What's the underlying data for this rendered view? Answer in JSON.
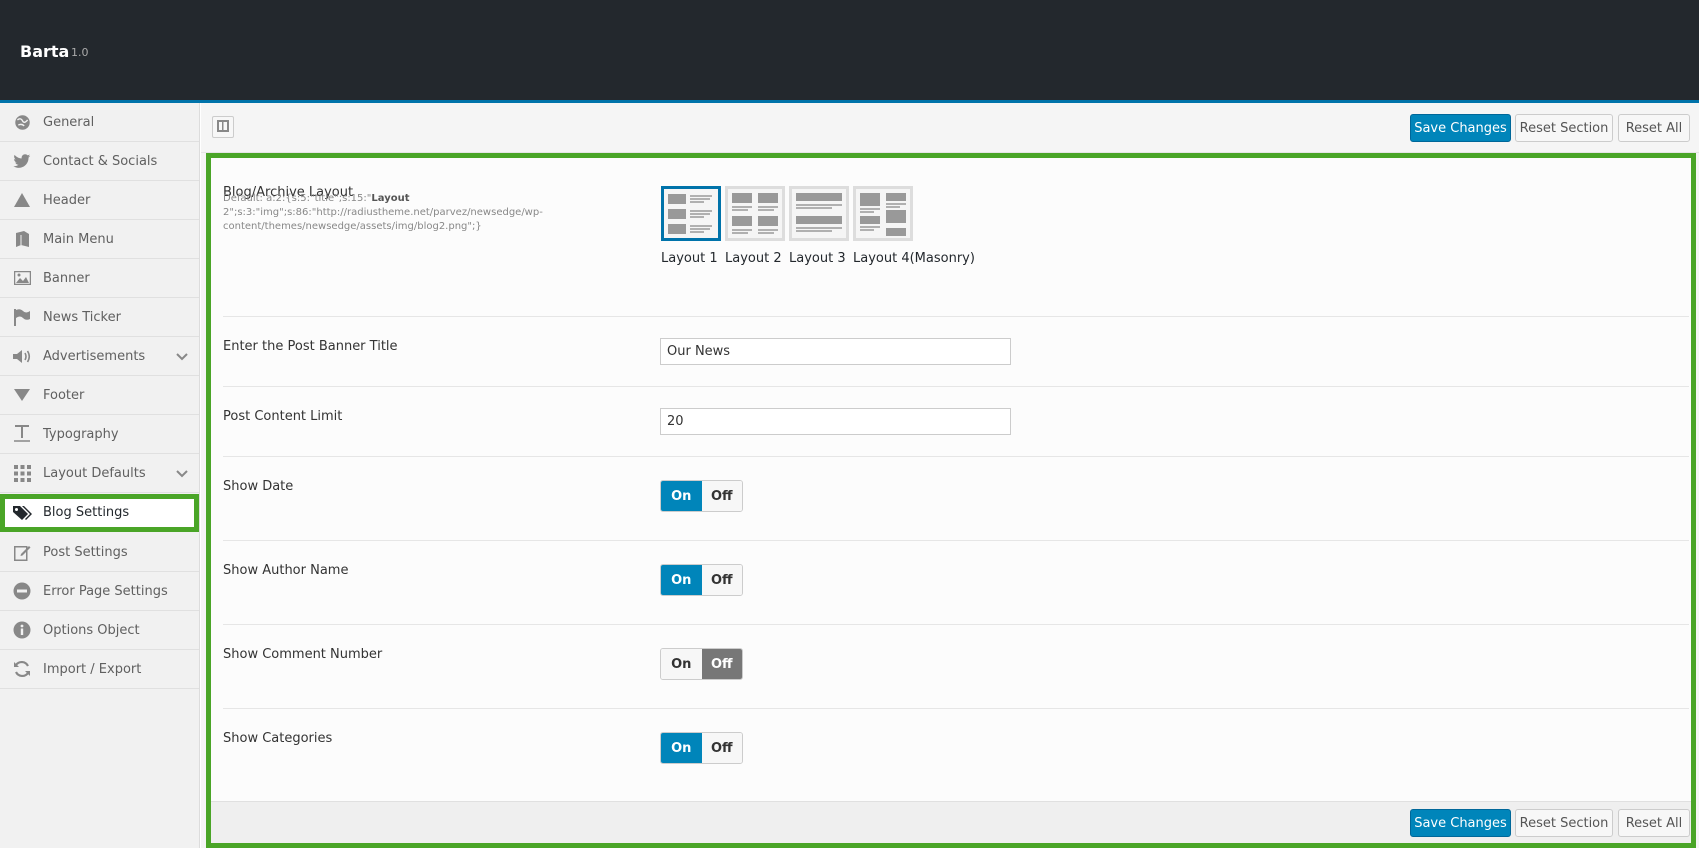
{
  "app": {
    "title": "Barta",
    "version": "1.0"
  },
  "sidebar": {
    "items": [
      {
        "label": "General",
        "icon": "globe-icon",
        "active": false
      },
      {
        "label": "Contact & Socials",
        "icon": "twitter-icon",
        "active": false
      },
      {
        "label": "Header",
        "icon": "triangle-icon",
        "active": false
      },
      {
        "label": "Main Menu",
        "icon": "book-icon",
        "active": false
      },
      {
        "label": "Banner",
        "icon": "image-icon",
        "active": false
      },
      {
        "label": "News Ticker",
        "icon": "flag-icon",
        "active": false
      },
      {
        "label": "Advertisements",
        "icon": "megaphone-icon",
        "active": false,
        "expandable": true
      },
      {
        "label": "Footer",
        "icon": "caret-down-icon",
        "active": false
      },
      {
        "label": "Typography",
        "icon": "text-icon",
        "active": false
      },
      {
        "label": "Layout Defaults",
        "icon": "grid-icon",
        "active": false,
        "expandable": true
      },
      {
        "label": "Blog Settings",
        "icon": "tags-icon",
        "active": true
      },
      {
        "label": "Post Settings",
        "icon": "edit-icon",
        "active": false
      },
      {
        "label": "Error Page Settings",
        "icon": "minus-circle-icon",
        "active": false
      },
      {
        "label": "Options Object",
        "icon": "info-icon",
        "active": false
      },
      {
        "label": "Import / Export",
        "icon": "refresh-icon",
        "active": false
      }
    ]
  },
  "toolbar": {
    "save_label": "Save Changes",
    "reset_section_label": "Reset Section",
    "reset_all_label": "Reset All"
  },
  "settings": {
    "blog_layout": {
      "title": "Blog/Archive Layout",
      "desc_prefix": "Default: a:2:{s:5:\"title\";s:15:\"",
      "desc_bold": "Layout",
      "desc_rest": " 2\";s:3:\"img\";s:86:\"http://radiustheme.net/parvez/newsedge/wp-content/themes/newsedge/assets/img/blog2.png\";}",
      "options": [
        "Layout 1",
        "Layout 2",
        "Layout 3",
        "Layout 4(Masonry)"
      ],
      "selected": "Layout 1"
    },
    "banner_title": {
      "title": "Enter the Post Banner Title",
      "value": "Our News"
    },
    "content_limit": {
      "title": "Post Content Limit",
      "value": "20"
    },
    "show_date": {
      "title": "Show Date",
      "on_label": "On",
      "off_label": "Off",
      "value": "On"
    },
    "show_author": {
      "title": "Show Author Name",
      "on_label": "On",
      "off_label": "Off",
      "value": "On"
    },
    "show_comments": {
      "title": "Show Comment Number",
      "on_label": "On",
      "off_label": "Off",
      "value": "Off"
    },
    "show_categories": {
      "title": "Show Categories",
      "on_label": "On",
      "off_label": "Off",
      "value": "On"
    }
  },
  "colors": {
    "accent": "#0085ba",
    "highlight": "#4aa527",
    "topbar": "#23282d"
  }
}
